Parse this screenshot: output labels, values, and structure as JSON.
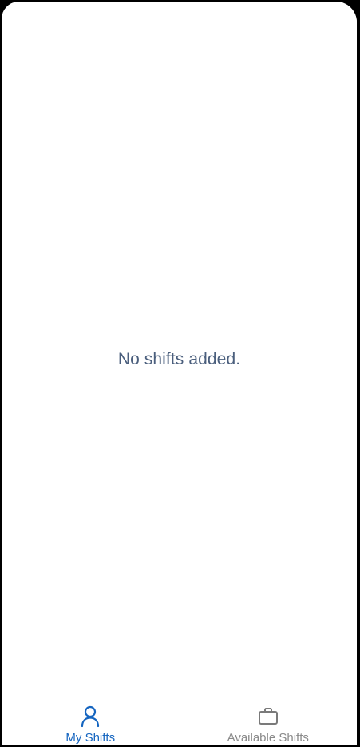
{
  "main": {
    "empty_message": "No shifts added."
  },
  "tabbar": {
    "tabs": [
      {
        "label": "My Shifts",
        "icon": "person-icon",
        "active": true
      },
      {
        "label": "Available Shifts",
        "icon": "briefcase-icon",
        "active": false
      }
    ]
  },
  "colors": {
    "accent": "#1565c0",
    "inactive": "#8a8a8a",
    "message": "#4b5f7d"
  }
}
